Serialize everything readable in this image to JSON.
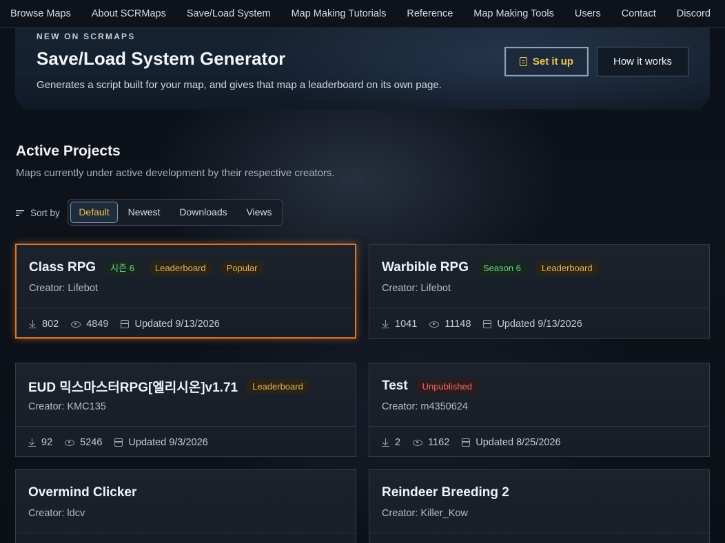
{
  "nav": {
    "items": [
      "Browse Maps",
      "About SCRMaps",
      "Save/Load System",
      "Map Making Tutorials",
      "Reference",
      "Map Making Tools",
      "Users",
      "Contact",
      "Discord"
    ]
  },
  "hero": {
    "eyebrow": "NEW ON SCRMAPS",
    "title": "Save/Load System Generator",
    "description": "Generates a script built for your map, and gives that map a leaderboard on its own page.",
    "primary_button": "Set it up",
    "secondary_button": "How it works"
  },
  "section": {
    "title": "Active Projects",
    "subtitle": "Maps currently under active development by their respective creators."
  },
  "sort": {
    "label": "Sort by",
    "options": [
      "Default",
      "Newest",
      "Downloads",
      "Views"
    ],
    "selected": "Default"
  },
  "cards": [
    {
      "title": "Class RPG",
      "badges": [
        {
          "text": "시즌 6",
          "kind": "season"
        },
        {
          "text": "Leaderboard",
          "kind": "leader"
        },
        {
          "text": "Popular",
          "kind": "popular"
        }
      ],
      "creator": "Creator: Lifebot",
      "downloads": "802",
      "views": "4849",
      "updated": "Updated 9/13/2026",
      "highlighted": true
    },
    {
      "title": "Warbible RPG",
      "badges": [
        {
          "text": "Season 6",
          "kind": "season"
        },
        {
          "text": "Leaderboard",
          "kind": "leader"
        }
      ],
      "creator": "Creator: Lifebot",
      "downloads": "1041",
      "views": "11148",
      "updated": "Updated 9/13/2026"
    },
    {
      "title": "EUD 믹스마스터RPG[엘리시온]v1.71",
      "badges": [
        {
          "text": "Leaderboard",
          "kind": "leader"
        }
      ],
      "creator": "Creator: KMC135",
      "downloads": "92",
      "views": "5246",
      "updated": "Updated 9/3/2026"
    },
    {
      "title": "Test",
      "badges": [
        {
          "text": "Unpublished",
          "kind": "unpub"
        }
      ],
      "creator": "Creator: m4350624",
      "downloads": "2",
      "views": "1162",
      "updated": "Updated 8/25/2026"
    },
    {
      "title": "Overmind Clicker",
      "badges": [],
      "creator": "Creator: ldcv"
    },
    {
      "title": "Reindeer Breeding 2",
      "badges": [],
      "creator": "Creator: Killer_Kow"
    }
  ]
}
